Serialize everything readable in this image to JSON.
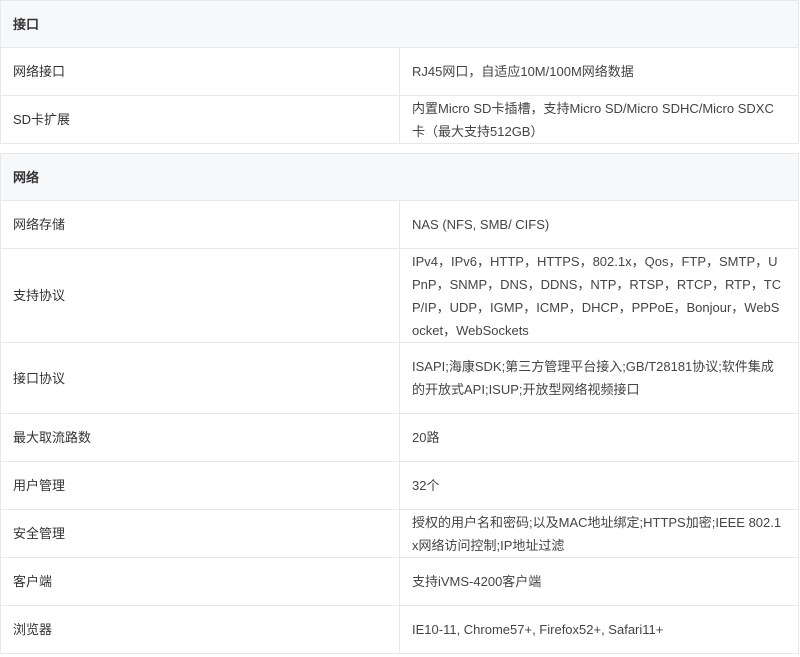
{
  "sections": [
    {
      "title": "接口",
      "rows": [
        {
          "label": "网络接口",
          "value": "RJ45网口，自适应10M/100M网络数据"
        },
        {
          "label": "SD卡扩展",
          "value": "内置Micro SD卡插槽，支持Micro SD/Micro SDHC/Micro SDXC卡（最大支持512GB）"
        }
      ]
    },
    {
      "title": "网络",
      "rows": [
        {
          "label": "网络存储",
          "value": "NAS (NFS, SMB/ CIFS)"
        },
        {
          "label": "支持协议",
          "value": "IPv4，IPv6，HTTP，HTTPS，802.1x，Qos，FTP，SMTP，UPnP，SNMP，DNS，DDNS，NTP，RTSP，RTCP，RTP，TCP/IP，UDP，IGMP，ICMP，DHCP，PPPoE，Bonjour，WebSocket，WebSockets"
        },
        {
          "label": "接口协议",
          "value": "ISAPI;海康SDK;第三方管理平台接入;GB/T28181协议;软件集成的开放式API;ISUP;开放型网络视频接口"
        },
        {
          "label": "最大取流路数",
          "value": "20路"
        },
        {
          "label": "用户管理",
          "value": "32个"
        },
        {
          "label": "安全管理",
          "value": "授权的用户名和密码;以及MAC地址绑定;HTTPS加密;IEEE 802.1x网络访问控制;IP地址过滤"
        },
        {
          "label": "客户端",
          "value": "支持iVMS-4200客户端"
        },
        {
          "label": "浏览器",
          "value": "IE10-11, Chrome57+, Firefox52+, Safari11+"
        }
      ]
    }
  ]
}
